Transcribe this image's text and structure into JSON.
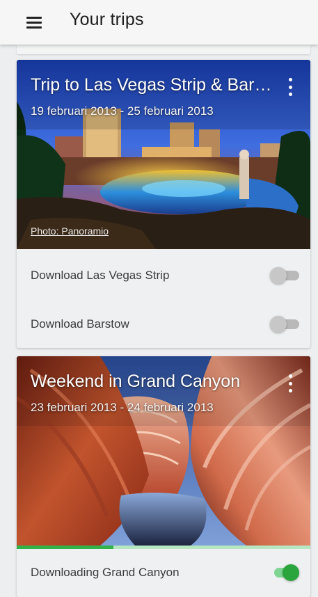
{
  "appbar": {
    "title": "Your trips",
    "menu_icon": "menu-icon"
  },
  "trips": [
    {
      "title": "Trip to Las Vegas Strip & Barsto...",
      "dates": "19 februari 2013 - 25 februari 2013",
      "photo_credit": "Photo: Panoramio",
      "downloads": [
        {
          "label": "Download Las Vegas Strip",
          "enabled": false
        },
        {
          "label": "Download Barstow",
          "enabled": false
        }
      ]
    },
    {
      "title": "Weekend in Grand Canyon",
      "dates": "23 februari 2013 - 24 februari 2013",
      "downloads": [
        {
          "label": "Downloading Grand Canyon",
          "enabled": true,
          "progress": 0.33
        }
      ]
    }
  ],
  "colors": {
    "accent": "#2aa43c",
    "accent_track": "#7fd694",
    "toggle_off": "#c7c7c7"
  }
}
